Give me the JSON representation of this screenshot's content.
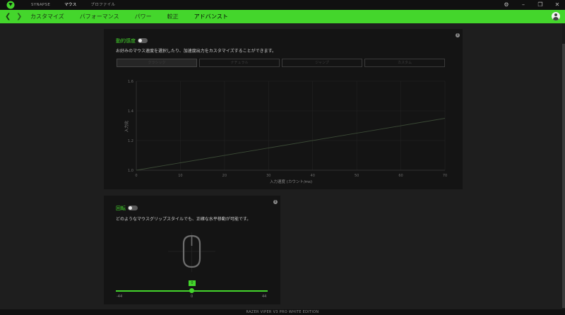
{
  "titlebar": {
    "tabs": [
      {
        "label": "SYNAPSE",
        "active": false
      },
      {
        "label": "マウス",
        "active": true
      },
      {
        "label": "プロファイル",
        "active": false
      }
    ]
  },
  "nav": {
    "tabs": [
      {
        "label": "カスタマイズ",
        "active": false
      },
      {
        "label": "パフォーマンス",
        "active": false
      },
      {
        "label": "パワー",
        "active": false
      },
      {
        "label": "較正",
        "active": false
      },
      {
        "label": "アドバンスト",
        "active": true
      }
    ]
  },
  "dynamic_sensitivity": {
    "title": "動的感度",
    "toggle_on": false,
    "description": "お好みのマウス速度を選択したり、加速度出力をカスタマイズすることができます。",
    "presets": [
      "クラシック",
      "ナチュラル",
      "ジャンプ",
      "カスタム"
    ],
    "active_preset_index": 0
  },
  "rotation": {
    "title": "回転",
    "toggle_on": false,
    "description": "どのようなマウスグリップスタイルでも、正確な水平移動が可能です。",
    "slider": {
      "min": -44,
      "max": 44,
      "value": 0,
      "min_label": "-44",
      "center_label": "0",
      "max_label": "44",
      "value_label": "0"
    }
  },
  "footer": {
    "device_name": "RAZER VIPER V3 PRO WHITE EDITION"
  },
  "colors": {
    "accent": "#44d62c",
    "panel": "#141414",
    "background": "#1e1e1e"
  },
  "chart_data": {
    "type": "line",
    "xlabel": "入力速度 (カウント/ms)",
    "ylabel": "入力比",
    "xlim": [
      0,
      70
    ],
    "ylim": [
      1.0,
      1.6
    ],
    "xticks": [
      0,
      10,
      20,
      30,
      40,
      50,
      60,
      70
    ],
    "yticks": [
      1.0,
      1.2,
      1.4,
      1.6
    ],
    "grid": true,
    "series": [
      {
        "x": [
          0,
          70
        ],
        "y": [
          1.0,
          1.35
        ]
      }
    ]
  }
}
